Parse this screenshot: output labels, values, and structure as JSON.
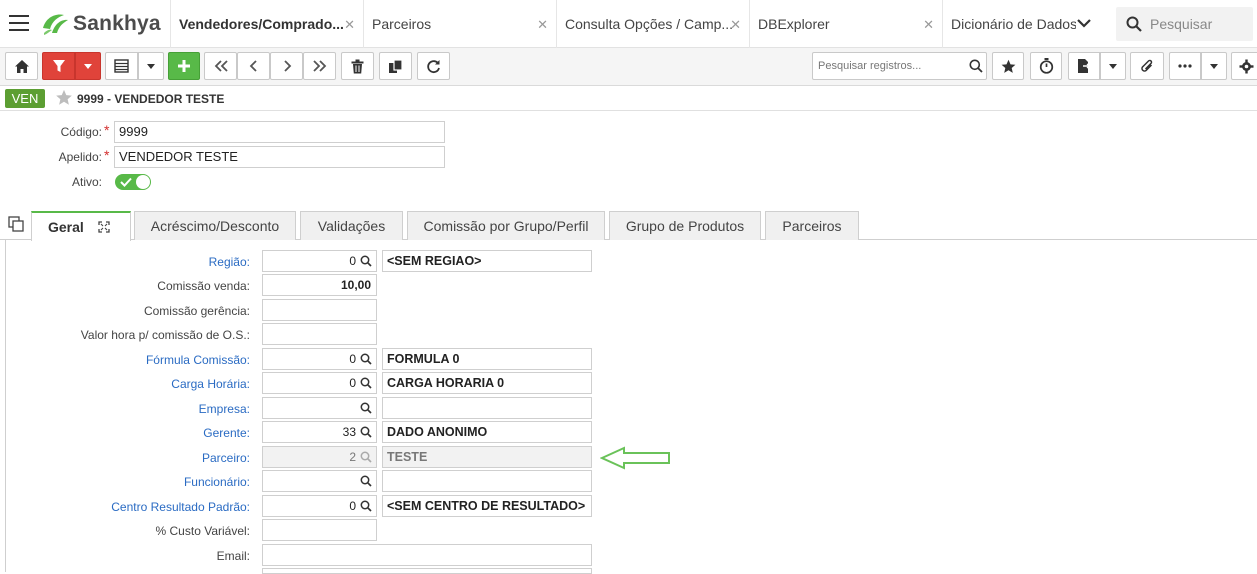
{
  "app": {
    "name": "Sankhya",
    "brand_color": "#58b948"
  },
  "top_tabs": [
    {
      "label": "Vendedores/Comprado...",
      "active": true
    },
    {
      "label": "Parceiros"
    },
    {
      "label": "Consulta Opções / Camp..."
    },
    {
      "label": "DBExplorer"
    },
    {
      "label": "Dicionário de Dados"
    }
  ],
  "global_search": {
    "placeholder": "Pesquisar"
  },
  "toolbar": {
    "search_placeholder": "Pesquisar registros...",
    "icons": [
      "home-icon",
      "filter-icon",
      "grid-icon",
      "add-icon",
      "first-icon",
      "prev-icon",
      "next-icon",
      "last-icon",
      "delete-icon",
      "duplicate-icon",
      "refresh-icon",
      "search-icon",
      "star-icon",
      "timer-icon",
      "export-icon",
      "attach-icon",
      "more-icon",
      "gear-icon"
    ]
  },
  "record": {
    "badge": "VEN",
    "title": "9999 - VENDEDOR TESTE"
  },
  "header_fields": {
    "codigo_label": "Código:",
    "codigo_value": "9999",
    "apelido_label": "Apelido:",
    "apelido_value": "VENDEDOR TESTE",
    "ativo_label": "Ativo:",
    "ativo_on": true
  },
  "form_tabs": [
    "Geral",
    "Acréscimo/Desconto",
    "Validações",
    "Comissão por Grupo/Perfil",
    "Grupo de Produtos",
    "Parceiros"
  ],
  "fields": {
    "regiao": {
      "label": "Região:",
      "code": "0",
      "desc": "<SEM REGIAO>"
    },
    "comissao_venda": {
      "label": "Comissão venda:",
      "value": "10,00"
    },
    "comissao_gerencia": {
      "label": "Comissão gerência:",
      "value": ""
    },
    "valor_hora": {
      "label": "Valor hora p/ comissão de O.S.:",
      "value": ""
    },
    "formula": {
      "label": "Fórmula Comissão:",
      "code": "0",
      "desc": "FORMULA 0"
    },
    "carga": {
      "label": "Carga Horária:",
      "code": "0",
      "desc": "CARGA HORARIA 0"
    },
    "empresa": {
      "label": "Empresa:",
      "code": "",
      "desc": ""
    },
    "gerente": {
      "label": "Gerente:",
      "code": "33",
      "desc": "DADO ANONIMO"
    },
    "parceiro": {
      "label": "Parceiro:",
      "code": "2",
      "desc": "TESTE"
    },
    "funcionario": {
      "label": "Funcionário:",
      "code": "",
      "desc": ""
    },
    "centro": {
      "label": "Centro Resultado Padrão:",
      "code": "0",
      "desc": "<SEM CENTRO DE RESULTADO>"
    },
    "custo": {
      "label": "% Custo Variável:",
      "value": ""
    },
    "email": {
      "label": "Email:",
      "value": ""
    }
  }
}
